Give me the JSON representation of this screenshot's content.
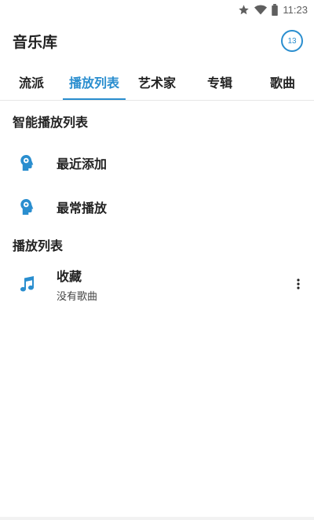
{
  "status_bar": {
    "time": "11:23",
    "icons": [
      "star-icon",
      "wifi-icon",
      "battery-icon"
    ]
  },
  "app_bar": {
    "title": "音乐库",
    "badge_count": "13"
  },
  "tabs": [
    {
      "label": "流派",
      "active": false
    },
    {
      "label": "播放列表",
      "active": true
    },
    {
      "label": "艺术家",
      "active": false
    },
    {
      "label": "专辑",
      "active": false
    },
    {
      "label": "歌曲",
      "active": false
    }
  ],
  "smart_playlists": {
    "header": "智能播放列表",
    "items": [
      {
        "label": "最近添加",
        "icon": "smart-playlist-icon"
      },
      {
        "label": "最常播放",
        "icon": "smart-playlist-icon"
      }
    ]
  },
  "playlists": {
    "header": "播放列表",
    "items": [
      {
        "label": "收藏",
        "subtitle": "没有歌曲",
        "icon": "music-note-icon"
      }
    ]
  },
  "colors": {
    "accent": "#2a8ecf",
    "text": "#212121",
    "icon_dark": "#5f5f5f"
  }
}
